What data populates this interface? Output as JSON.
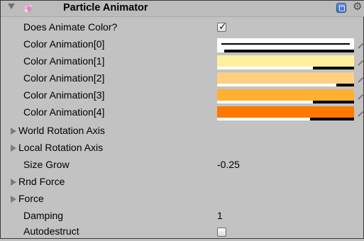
{
  "component": {
    "title": "Particle Animator",
    "icon": "particle-component-icon",
    "help_icon": "help-book-icon",
    "settings_icon": "gear-icon"
  },
  "fields": {
    "does_animate_color": {
      "label": "Does Animate Color?",
      "checked": true
    },
    "color_animation": [
      {
        "label": "Color Animation[0]",
        "color": "#ffffff",
        "alpha": 0.05
      },
      {
        "label": "Color Animation[1]",
        "color": "#fff0a0",
        "alpha": 0.7
      },
      {
        "label": "Color Animation[2]",
        "color": "#ffd080",
        "alpha": 0.87
      },
      {
        "label": "Color Animation[3]",
        "color": "#ffb030",
        "alpha": 0.7
      },
      {
        "label": "Color Animation[4]",
        "color": "#ff7800",
        "alpha": 0.68
      }
    ],
    "world_rotation_axis": {
      "label": "World Rotation Axis"
    },
    "local_rotation_axis": {
      "label": "Local Rotation Axis"
    },
    "size_grow": {
      "label": "Size Grow",
      "value": "-0.25"
    },
    "rnd_force": {
      "label": "Rnd Force"
    },
    "force": {
      "label": "Force"
    },
    "damping": {
      "label": "Damping",
      "value": "1"
    },
    "autodestruct": {
      "label": "Autodestruct",
      "checked": false
    }
  }
}
